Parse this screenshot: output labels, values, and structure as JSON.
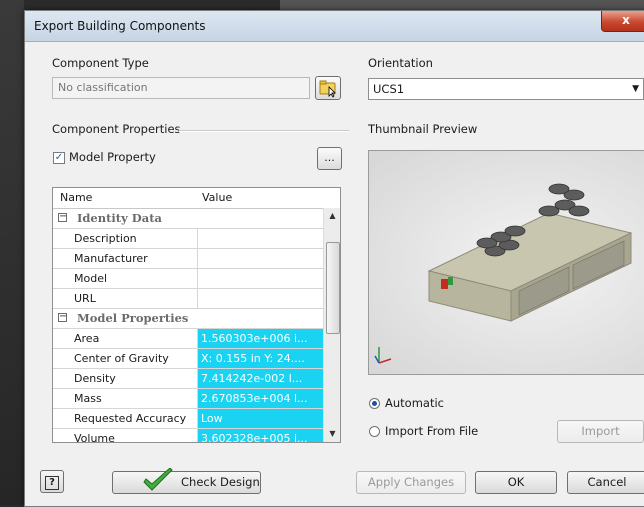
{
  "window": {
    "title": "Export Building Components",
    "close_label": "x"
  },
  "component_type": {
    "label": "Component Type",
    "value": "No classification"
  },
  "orientation": {
    "label": "Orientation",
    "value": "UCS1"
  },
  "component_properties": {
    "label": "Component Properties",
    "model_property_label": "Model Property",
    "model_property_checked": true,
    "browse_label": "..."
  },
  "thumbnail": {
    "label": "Thumbnail Preview"
  },
  "grid": {
    "headers": [
      "Name",
      "Value"
    ],
    "rows": [
      {
        "type": "category",
        "name": "Identity Data"
      },
      {
        "type": "item",
        "name": "Description",
        "value": ""
      },
      {
        "type": "item",
        "name": "Manufacturer",
        "value": ""
      },
      {
        "type": "item",
        "name": "Model",
        "value": ""
      },
      {
        "type": "item",
        "name": "URL",
        "value": ""
      },
      {
        "type": "category",
        "name": "Model Properties"
      },
      {
        "type": "item",
        "name": "Area",
        "value": "1.560303e+006 i..."
      },
      {
        "type": "item",
        "name": "Center of Gravity",
        "value": "X: 0.155 in Y: 24...."
      },
      {
        "type": "item",
        "name": "Density",
        "value": "7.414242e-002 l..."
      },
      {
        "type": "item",
        "name": "Mass",
        "value": "2.670853e+004 l..."
      },
      {
        "type": "item",
        "name": "Requested Accuracy",
        "value": "Low"
      },
      {
        "type": "item",
        "name": "Volume",
        "value": "3.602328e+005 i..."
      }
    ],
    "minus": "−"
  },
  "thumbnail_source": {
    "automatic_label": "Automatic",
    "import_label": "Import From File",
    "selected": "automatic",
    "import_button": "Import"
  },
  "buttons": {
    "help": "?",
    "check_design": "Check Design",
    "apply": "Apply Changes",
    "ok": "OK",
    "cancel": "Cancel"
  },
  "icons": {
    "folder": "folder-icon",
    "check": "checkmark-icon",
    "help": "help-icon"
  },
  "colors": {
    "highlight": "#1ad2f2",
    "title_bar": "#c6d4e4",
    "close": "#c9482f"
  }
}
